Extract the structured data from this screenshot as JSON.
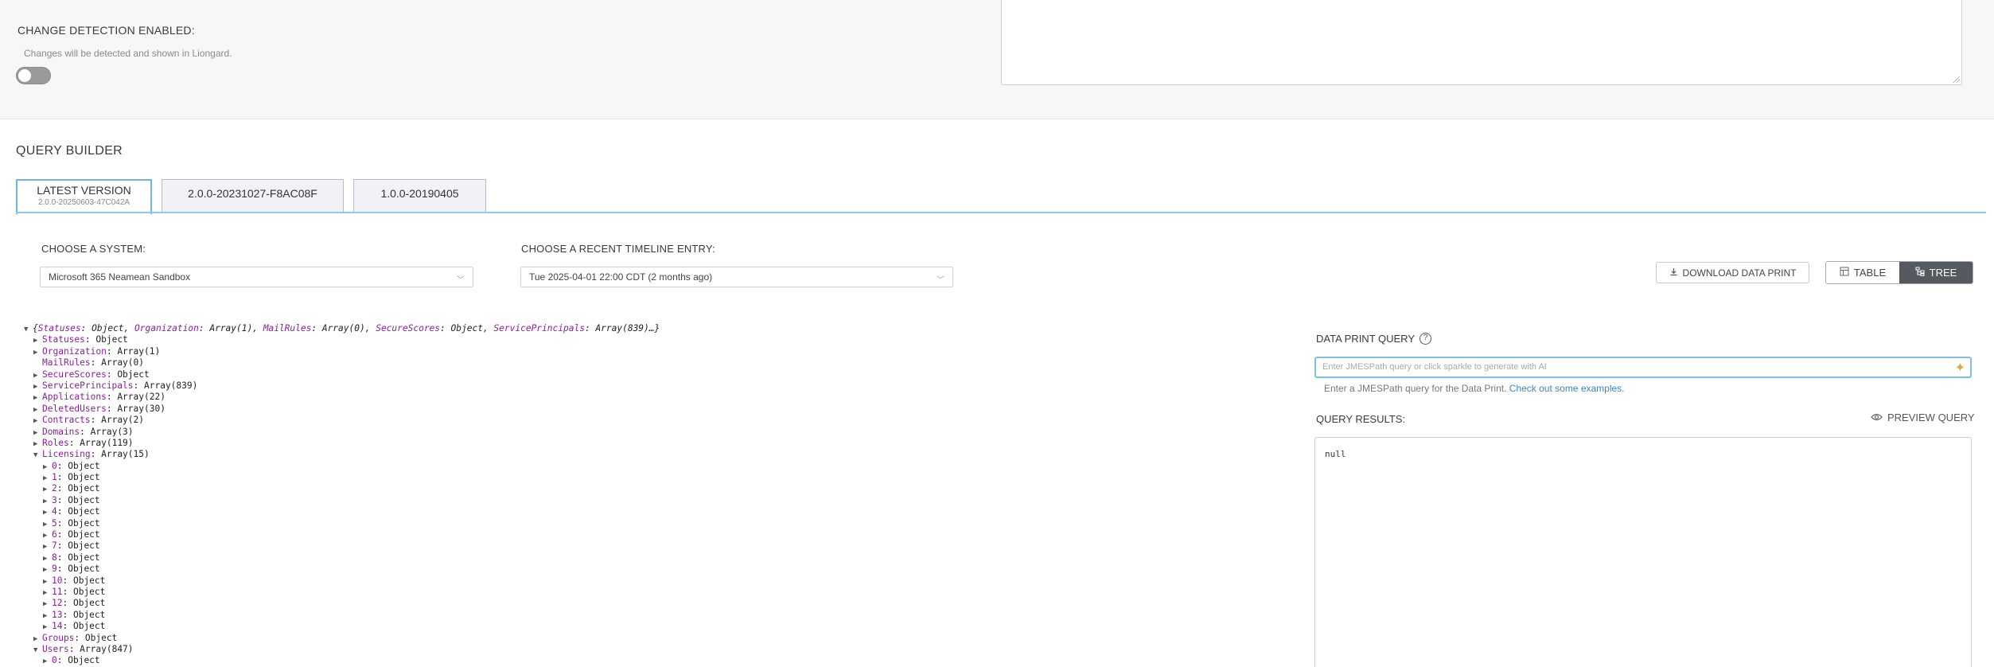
{
  "change_detection": {
    "label": "CHANGE DETECTION ENABLED:",
    "help": "Changes will be detected and shown in Liongard.",
    "enabled": false
  },
  "query_builder": {
    "title": "QUERY BUILDER",
    "tabs": [
      {
        "label": "LATEST VERSION",
        "sub": "2.0.0-20250603-47C042A",
        "active": true
      },
      {
        "label": "2.0.0-20231027-F8AC08F",
        "active": false
      },
      {
        "label": "1.0.0-20190405",
        "active": false
      }
    ],
    "system_label": "CHOOSE A SYSTEM:",
    "system_value": "Microsoft 365 Neamean Sandbox",
    "timeline_label": "CHOOSE A RECENT TIMELINE ENTRY:",
    "timeline_value": "Tue 2025-04-01 22:00 CDT (2 months ago)",
    "download_label": "DOWNLOAD DATA PRINT",
    "view_table": "TABLE",
    "view_tree": "TREE"
  },
  "tree": {
    "root": {
      "brace_open": "{",
      "items": [
        {
          "key": "Statuses",
          "val": "Object"
        },
        {
          "key": "Organization",
          "val": "Array(1)"
        },
        {
          "key": "MailRules",
          "val": "Array(0)"
        },
        {
          "key": "SecureScores",
          "val": "Object"
        },
        {
          "key": "ServicePrincipals",
          "val": "Array(839)"
        }
      ],
      "brace_close": "…}"
    },
    "rows": [
      {
        "indent": 1,
        "arrow": "▶",
        "key": "Statuses",
        "val": "Object"
      },
      {
        "indent": 1,
        "arrow": "▶",
        "key": "Organization",
        "val": "Array(1)"
      },
      {
        "indent": 1,
        "arrow": "",
        "key": "MailRules",
        "val": "Array(0)"
      },
      {
        "indent": 1,
        "arrow": "▶",
        "key": "SecureScores",
        "val": "Object"
      },
      {
        "indent": 1,
        "arrow": "▶",
        "key": "ServicePrincipals",
        "val": "Array(839)"
      },
      {
        "indent": 1,
        "arrow": "▶",
        "key": "Applications",
        "val": "Array(22)"
      },
      {
        "indent": 1,
        "arrow": "▶",
        "key": "DeletedUsers",
        "val": "Array(30)"
      },
      {
        "indent": 1,
        "arrow": "▶",
        "key": "Contracts",
        "val": "Array(2)"
      },
      {
        "indent": 1,
        "arrow": "▶",
        "key": "Domains",
        "val": "Array(3)"
      },
      {
        "indent": 1,
        "arrow": "▶",
        "key": "Roles",
        "val": "Array(119)"
      },
      {
        "indent": 1,
        "arrow": "▼",
        "key": "Licensing",
        "val": "Array(15)"
      },
      {
        "indent": 2,
        "arrow": "▶",
        "key": "0",
        "val": "Object"
      },
      {
        "indent": 2,
        "arrow": "▶",
        "key": "1",
        "val": "Object"
      },
      {
        "indent": 2,
        "arrow": "▶",
        "key": "2",
        "val": "Object"
      },
      {
        "indent": 2,
        "arrow": "▶",
        "key": "3",
        "val": "Object"
      },
      {
        "indent": 2,
        "arrow": "▶",
        "key": "4",
        "val": "Object"
      },
      {
        "indent": 2,
        "arrow": "▶",
        "key": "5",
        "val": "Object"
      },
      {
        "indent": 2,
        "arrow": "▶",
        "key": "6",
        "val": "Object"
      },
      {
        "indent": 2,
        "arrow": "▶",
        "key": "7",
        "val": "Object"
      },
      {
        "indent": 2,
        "arrow": "▶",
        "key": "8",
        "val": "Object"
      },
      {
        "indent": 2,
        "arrow": "▶",
        "key": "9",
        "val": "Object"
      },
      {
        "indent": 2,
        "arrow": "▶",
        "key": "10",
        "val": "Object"
      },
      {
        "indent": 2,
        "arrow": "▶",
        "key": "11",
        "val": "Object"
      },
      {
        "indent": 2,
        "arrow": "▶",
        "key": "12",
        "val": "Object"
      },
      {
        "indent": 2,
        "arrow": "▶",
        "key": "13",
        "val": "Object"
      },
      {
        "indent": 2,
        "arrow": "▶",
        "key": "14",
        "val": "Object"
      },
      {
        "indent": 1,
        "arrow": "▶",
        "key": "Groups",
        "val": "Object"
      },
      {
        "indent": 1,
        "arrow": "▼",
        "key": "Users",
        "val": "Array(847)"
      },
      {
        "indent": 2,
        "arrow": "▶",
        "key": "0",
        "val": "Object"
      }
    ]
  },
  "right_panel": {
    "dpq_label": "DATA PRINT QUERY",
    "query_placeholder": "Enter JMESPath query or click sparkle to generate with AI",
    "help_text": "Enter a JMESPath query for the Data Print. ",
    "help_link": "Check out some examples.",
    "results_label": "QUERY RESULTS:",
    "preview_label": "PREVIEW QUERY",
    "results_value": "null"
  },
  "colors": {
    "accent": "#7cc0e4",
    "key": "#8a1f9a",
    "tree_active": "#555a60"
  },
  "icons": [
    "download-icon",
    "table-icon",
    "tree-icon",
    "help-circle-icon",
    "sparkle-icon",
    "eye-icon",
    "chevron-down-icon",
    "triangle-right-icon",
    "triangle-down-icon"
  ]
}
